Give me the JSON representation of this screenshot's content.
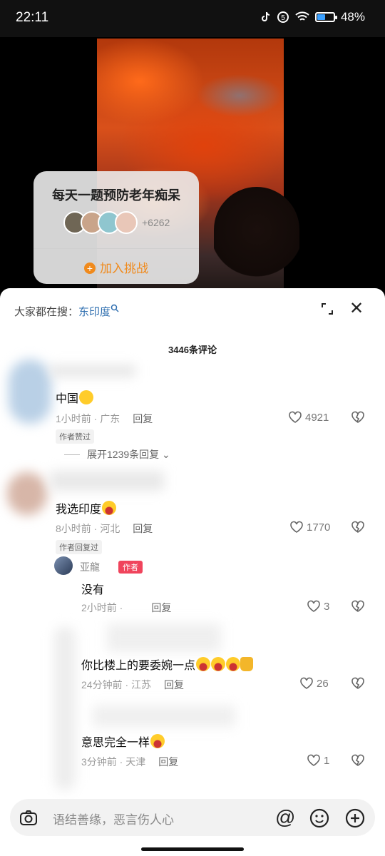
{
  "status_bar": {
    "time": "22:11",
    "battery": "48%",
    "battery_level": 0.48
  },
  "challenge": {
    "title": "每天一题预防老年痴呆",
    "participants": "+6262",
    "join_label": "加入挑战"
  },
  "sheet": {
    "search_prefix": "大家都在搜：",
    "search_keyword": "东印度",
    "comment_count": "3446条评论"
  },
  "comments": [
    {
      "text": "中国",
      "time": "1小时前 · 广东",
      "reply": "回复",
      "likes": "4921",
      "tag": "作者赞过",
      "expand": "展开1239条回复"
    },
    {
      "text": "我选印度",
      "time": "8小时前 · 河北",
      "reply": "回复",
      "likes": "1770",
      "tag": "作者回复过"
    }
  ],
  "replies": [
    {
      "name": "亚龍",
      "badge": "作者",
      "text": "没有",
      "time": "2小时前 ·",
      "reply": "回复",
      "likes": "3"
    },
    {
      "text": "你比楼上的要委婉一点",
      "time": "24分钟前 · 江苏",
      "reply": "回复",
      "likes": "26"
    },
    {
      "text": "意思完全一样",
      "time": "3分钟前 · 天津",
      "reply": "回复",
      "likes": "1"
    }
  ],
  "input": {
    "placeholder": "语结善缘，恶言伤人心",
    "at": "@"
  }
}
